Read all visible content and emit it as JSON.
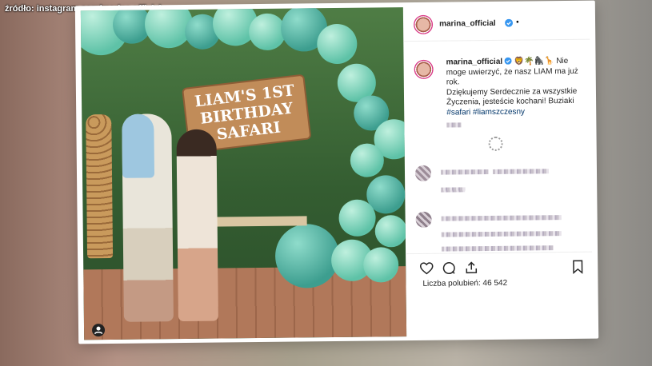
{
  "source_label": "źródło: instagram.com/marina.official",
  "post": {
    "username": "marina_official",
    "dot": "•",
    "caption_user": "marina_official",
    "caption_emojis": "🦁🌴🦍🦒",
    "caption_line1": "Nie moge uwierzyć, że nasz LIAM ma już rok.",
    "caption_line2": "Dziękujemy Serdecznie za wszystkie Życzenia, jesteście kochani! Buziaki",
    "caption_tags": "#safari #liamszczesny",
    "likes_label": "Liczba polubień:",
    "likes_count": "46 542",
    "sign_text": "LIAM'S 1ST BIRTHDAY SAFARI"
  },
  "colors": {
    "verified": "#3897f0",
    "accent_green": "#5ec2a7"
  }
}
